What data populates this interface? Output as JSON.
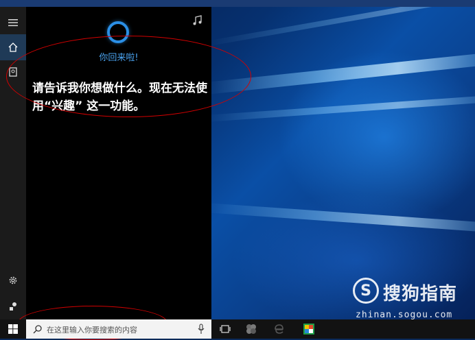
{
  "cortana": {
    "greeting": "你回来啦!",
    "message": "请告诉我你想做什么。现在无法使用“兴趣” 这一功能。"
  },
  "rail": {
    "items": [
      {
        "icon": "hamburger-menu-icon"
      },
      {
        "icon": "home-icon",
        "active": true
      },
      {
        "icon": "notebook-icon"
      },
      {
        "icon": "settings-icon"
      },
      {
        "icon": "feedback-icon"
      }
    ]
  },
  "taskbar": {
    "search_placeholder": "在这里输入你要搜索的内容",
    "items": [
      "task-view-icon",
      "app-icon",
      "edge-icon",
      "store-icon"
    ]
  },
  "watermark": {
    "logo_letter": "S",
    "name": "搜狗指南",
    "url": "zhinan.sogou.com"
  },
  "colors": {
    "accent": "#2b8fe6",
    "annotation": "#d40000"
  }
}
